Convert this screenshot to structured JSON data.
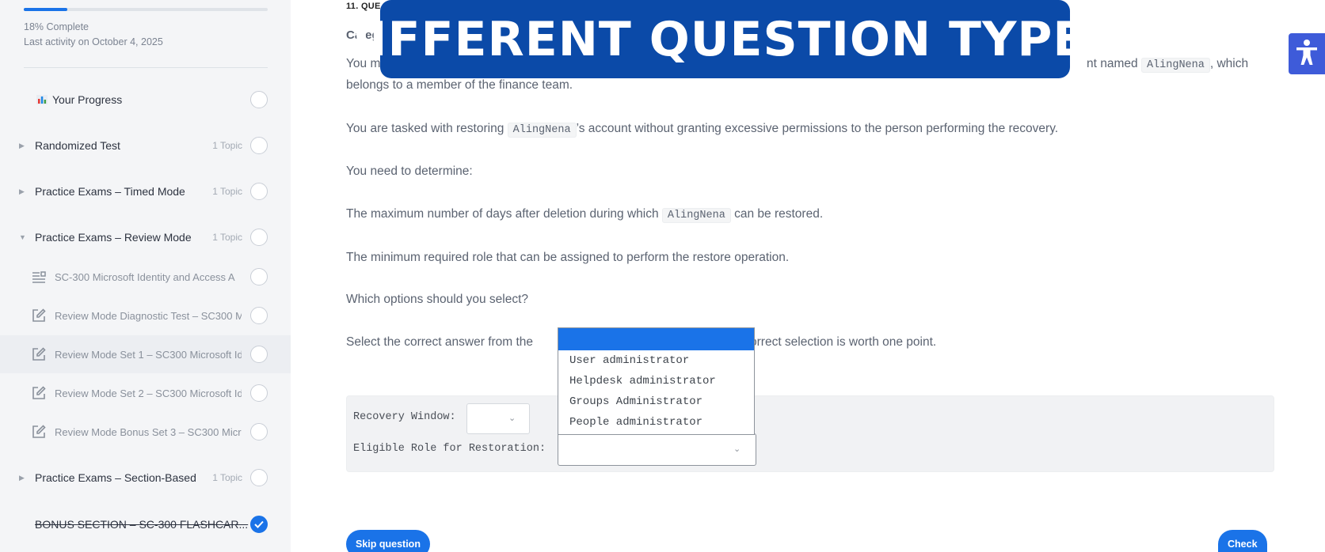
{
  "sidebar": {
    "progress": {
      "percent": 18,
      "percent_label": "18% Complete",
      "last_activity": "Last activity on October 4, 2025"
    },
    "your_progress": "Your Progress",
    "sections": [
      {
        "label": "Randomized Test",
        "topics": "1 Topic",
        "expanded": false
      },
      {
        "label": "Practice Exams – Timed Mode",
        "topics": "1 Topic",
        "expanded": false
      },
      {
        "label": "Practice Exams – Review Mode",
        "topics": "1 Topic",
        "expanded": true
      },
      {
        "label": "Practice Exams – Section-Based",
        "topics": "1 Topic",
        "expanded": false
      },
      {
        "label": "BONUS SECTION – SC-300 FLASHCAR...",
        "completed": true
      }
    ],
    "sub_items": [
      {
        "label": "SC-300 Microsoft Identity and Access A",
        "icon": "lines-icon"
      },
      {
        "label": "Review Mode Diagnostic Test – SC300 M",
        "icon": "edit-icon"
      },
      {
        "label": "Review Mode Set 1 – SC300 Microsoft Id",
        "icon": "edit-icon",
        "active": true
      },
      {
        "label": "Review Mode Set 2 – SC300 Microsoft Id",
        "icon": "edit-icon"
      },
      {
        "label": "Review Mode Bonus Set 3 – SC300 Micr",
        "icon": "edit-icon"
      }
    ]
  },
  "question": {
    "header": "11. QUE",
    "category": "Categ",
    "p1_a": "You m",
    "p1_b": "nt named",
    "p1_code": "AlingNena",
    "p1_c": ", which",
    "p1_line2": "belongs to a member of the finance team.",
    "p2_a": "You are tasked with restoring",
    "p2_code": "AlingNena",
    "p2_b": "’s account without granting excessive permissions to the person performing the recovery.",
    "p3": "You need to determine:",
    "p4_a": "The maximum number of days after deletion during which",
    "p4_code": "AlingNena",
    "p4_b": "can be restored.",
    "p5": "The minimum required role that can be assigned to perform the restore operation.",
    "p6": "Which options should you select?",
    "p7_a": "Select the correct answer from the",
    "p7_b": "orrect selection is worth one point."
  },
  "answers": {
    "recovery_label": "Recovery Window:",
    "role_label": "Eligible Role for Restoration:",
    "dropdown_options": [
      "User administrator",
      "Helpdesk administrator",
      "Groups Administrator",
      "People administrator"
    ]
  },
  "buttons": {
    "skip": "Skip question",
    "check": "Check"
  },
  "banner": "DIFFERENT QUESTION TYPES",
  "colors": {
    "accent": "#1a73e8",
    "banner": "#0b4aa8",
    "accessibility": "#3e5bd9"
  }
}
